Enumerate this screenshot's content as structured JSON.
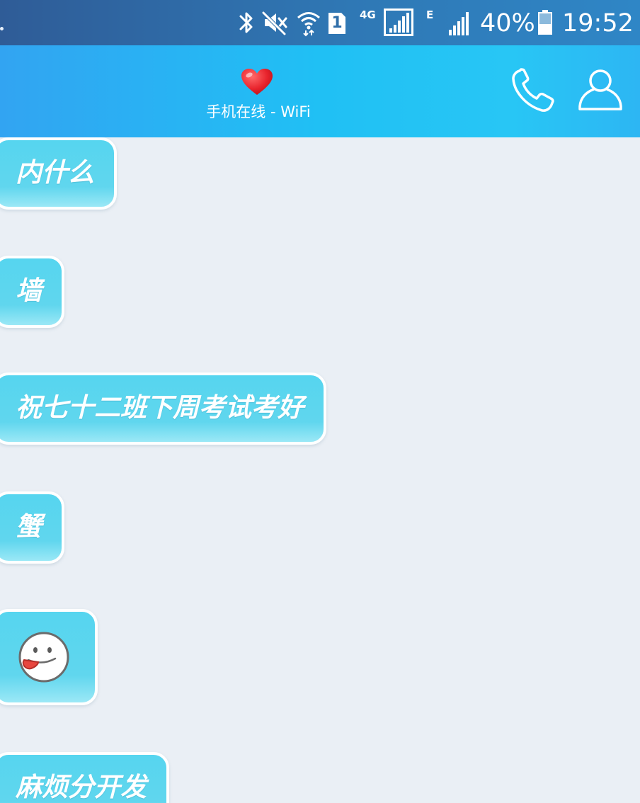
{
  "status_bar": {
    "icons": [
      "bluetooth-icon",
      "mute-icon",
      "wifi-icon",
      "sim1-icon",
      "signal-4g-icon",
      "signal-edge-icon",
      "battery-icon"
    ],
    "network_4g": "4G",
    "network_edge": "E",
    "sim_slot": "1",
    "battery_percent": "40%",
    "time": "19:52"
  },
  "header": {
    "status_text": "手机在线 - WiFi",
    "icons": [
      "heart-icon",
      "phone-icon",
      "profile-icon"
    ]
  },
  "messages": [
    {
      "type": "text",
      "text": "内什么"
    },
    {
      "type": "text",
      "text": "墙"
    },
    {
      "type": "text",
      "text": "祝七十二班下周考试考好"
    },
    {
      "type": "text",
      "text": "蟹"
    },
    {
      "type": "emoji",
      "icon": "tongue-out-face-icon"
    },
    {
      "type": "text",
      "text": "麻烦分开发"
    }
  ],
  "colors": {
    "status_bar": "#2f6ea9",
    "header": "#22bdf4",
    "chat_background": "#eaeff5",
    "bubble": "#5ad5ef",
    "bubble_border": "#ffffff"
  }
}
